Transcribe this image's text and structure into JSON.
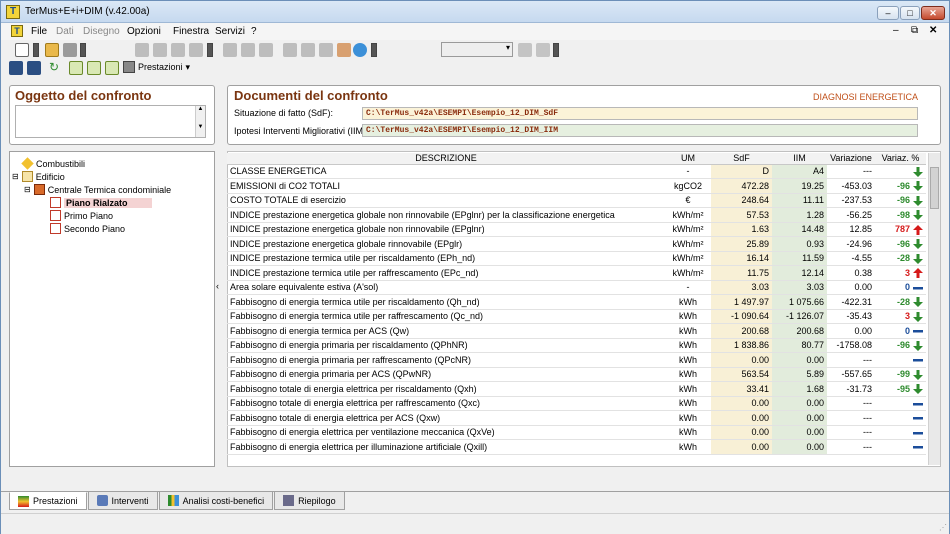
{
  "window": {
    "title": "TerMus+E+i+DIM (v.42.00a)"
  },
  "menu": {
    "items": [
      "File",
      "Dati",
      "Disegno",
      "Opzioni",
      "Finestra",
      "Servizi",
      "?"
    ]
  },
  "toolbar": {
    "prestazioni_label": "Prestazioni"
  },
  "left": {
    "object_title": "Oggetto del confronto",
    "tree": [
      {
        "label": "Combustibili",
        "icon": "fuel-icon"
      },
      {
        "label": "Edificio",
        "icon": "house-icon"
      },
      {
        "label": "Centrale Termica condominiale",
        "icon": "boiler-icon"
      },
      {
        "label": "Piano Rialzato",
        "icon": "floor-icon",
        "selected": true
      },
      {
        "label": "Primo Piano",
        "icon": "floor-icon"
      },
      {
        "label": "Secondo Piano",
        "icon": "floor-icon"
      }
    ]
  },
  "docs": {
    "title": "Documenti del confronto",
    "badge": "DIAGNOSI ENERGETICA",
    "sdf_label": "Situazione di fatto (SdF):",
    "sdf_path": "C:\\TerMus_v42a\\ESEMPI\\Esempio_12_DIM_SdF",
    "iim_label": "Ipotesi Interventi Migliorativi (IIM):",
    "iim_path": "C:\\TerMus_v42a\\ESEMPI\\Esempio_12_DIM_IIM"
  },
  "table": {
    "headers": [
      "DESCRIZIONE",
      "UM",
      "SdF",
      "IIM",
      "Variazione",
      "Variaz. %"
    ],
    "rows": [
      {
        "d": "CLASSE ENERGETICA",
        "um": "-",
        "sdf": "D",
        "iim": "A4",
        "var": "---",
        "pct": "",
        "trend": "down",
        "color": "green"
      },
      {
        "d": "EMISSIONI di CO2 TOTALI",
        "um": "kgCO2",
        "sdf": "472.28",
        "iim": "19.25",
        "var": "-453.03",
        "pct": "-96",
        "trend": "down",
        "color": "green"
      },
      {
        "d": "COSTO TOTALE di esercizio",
        "um": "€",
        "sdf": "248.64",
        "iim": "11.11",
        "var": "-237.53",
        "pct": "-96",
        "trend": "down",
        "color": "green"
      },
      {
        "d": "INDICE prestazione energetica globale non rinnovabile (EPglnr) per la classificazione energetica",
        "um": "kWh/m²",
        "sdf": "57.53",
        "iim": "1.28",
        "var": "-56.25",
        "pct": "-98",
        "trend": "down",
        "color": "green"
      },
      {
        "d": "INDICE prestazione energetica globale non rinnovabile (EPglnr)",
        "um": "kWh/m²",
        "sdf": "1.63",
        "iim": "14.48",
        "var": "12.85",
        "pct": "787",
        "trend": "up",
        "color": "red"
      },
      {
        "d": "INDICE prestazione energetica globale rinnovabile (EPglr)",
        "um": "kWh/m²",
        "sdf": "25.89",
        "iim": "0.93",
        "var": "-24.96",
        "pct": "-96",
        "trend": "down",
        "color": "green"
      },
      {
        "d": "INDICE prestazione termica utile per riscaldamento (EPh_nd)",
        "um": "kWh/m²",
        "sdf": "16.14",
        "iim": "11.59",
        "var": "-4.55",
        "pct": "-28",
        "trend": "down",
        "color": "green"
      },
      {
        "d": "INDICE prestazione termica utile per raffrescamento (EPc_nd)",
        "um": "kWh/m²",
        "sdf": "11.75",
        "iim": "12.14",
        "var": "0.38",
        "pct": "3",
        "trend": "up",
        "color": "red"
      },
      {
        "d": "Area solare equivalente estiva (A'sol)",
        "um": "-",
        "sdf": "3.03",
        "iim": "3.03",
        "var": "0.00",
        "pct": "0",
        "trend": "flat",
        "color": "blue"
      },
      {
        "d": "Fabbisogno di energia termica utile per riscaldamento (Qh_nd)",
        "um": "kWh",
        "sdf": "1 497.97",
        "iim": "1 075.66",
        "var": "-422.31",
        "pct": "-28",
        "trend": "down",
        "color": "green"
      },
      {
        "d": "Fabbisogno di energia termica utile per raffrescamento (Qc_nd)",
        "um": "kWh",
        "sdf": "-1 090.64",
        "iim": "-1 126.07",
        "var": "-35.43",
        "pct": "3",
        "trend": "down",
        "color": "red"
      },
      {
        "d": "Fabbisogno di energia termica per ACS (Qw)",
        "um": "kWh",
        "sdf": "200.68",
        "iim": "200.68",
        "var": "0.00",
        "pct": "0",
        "trend": "flat",
        "color": "blue"
      },
      {
        "d": "Fabbisogno di energia primaria per riscaldamento (QPhNR)",
        "um": "kWh",
        "sdf": "1 838.86",
        "iim": "80.77",
        "var": "-1758.08",
        "pct": "-96",
        "trend": "down",
        "color": "green"
      },
      {
        "d": "Fabbisogno di energia primaria per raffrescamento (QPcNR)",
        "um": "kWh",
        "sdf": "0.00",
        "iim": "0.00",
        "var": "---",
        "pct": "",
        "trend": "flat",
        "color": "blue"
      },
      {
        "d": "Fabbisogno di energia primaria per ACS (QPwNR)",
        "um": "kWh",
        "sdf": "563.54",
        "iim": "5.89",
        "var": "-557.65",
        "pct": "-99",
        "trend": "down",
        "color": "green"
      },
      {
        "d": "Fabbisogno totale di energia elettrica per riscaldamento (Qxh)",
        "um": "kWh",
        "sdf": "33.41",
        "iim": "1.68",
        "var": "-31.73",
        "pct": "-95",
        "trend": "down",
        "color": "green"
      },
      {
        "d": "Fabbisogno totale di energia elettrica per raffrescamento (Qxc)",
        "um": "kWh",
        "sdf": "0.00",
        "iim": "0.00",
        "var": "---",
        "pct": "",
        "trend": "flat",
        "color": "blue"
      },
      {
        "d": "Fabbisogno totale di energia elettrica per ACS (Qxw)",
        "um": "kWh",
        "sdf": "0.00",
        "iim": "0.00",
        "var": "---",
        "pct": "",
        "trend": "flat",
        "color": "blue"
      },
      {
        "d": "Fabbisogno di energia elettrica per ventilazione meccanica (QxVe)",
        "um": "kWh",
        "sdf": "0.00",
        "iim": "0.00",
        "var": "---",
        "pct": "",
        "trend": "flat",
        "color": "blue"
      },
      {
        "d": "Fabbisogno di energia elettrica per illuminazione artificiale (Qxill)",
        "um": "kWh",
        "sdf": "0.00",
        "iim": "0.00",
        "var": "---",
        "pct": "",
        "trend": "flat",
        "color": "blue"
      }
    ]
  },
  "tabs": [
    {
      "label": "Prestazioni",
      "icon": "energy-class-icon",
      "active": true
    },
    {
      "label": "Interventi",
      "icon": "tools-icon"
    },
    {
      "label": "Analisi costi-benefici",
      "icon": "chart-icon"
    },
    {
      "label": "Riepilogo",
      "icon": "summary-icon"
    }
  ],
  "colors": {
    "title_brown": "#7a3510",
    "badge_orange": "#c0501a",
    "up_red": "#d61a1a",
    "down_green": "#2e8b2e",
    "flat_blue": "#1b4d9a",
    "sdf_bg": "#f8f0d6",
    "iim_bg": "#e2ecdc"
  }
}
